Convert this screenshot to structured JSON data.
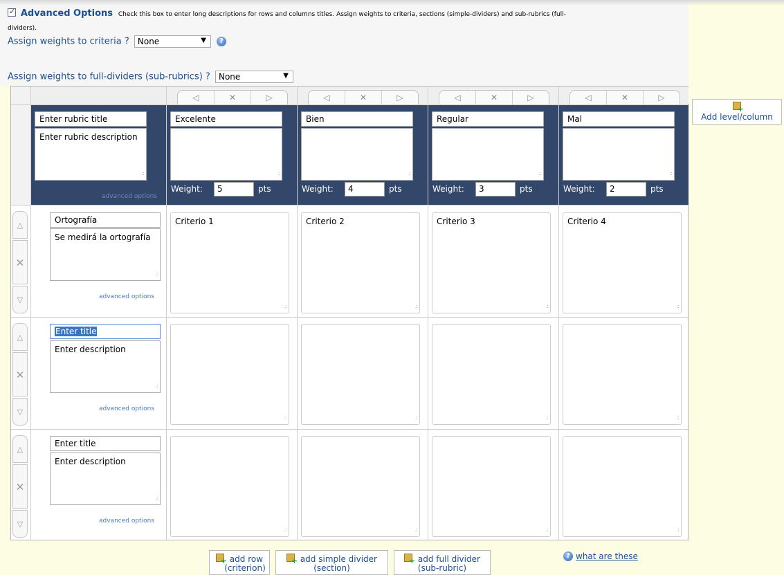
{
  "advanced": {
    "checked": true,
    "title": "Advanced Options",
    "description": "Check this box to enter long descriptions for rows and columns titles. Assign weights to criteria, sections (simple-dividers) and sub-rubrics (full-",
    "description_cont": "dividers)."
  },
  "criteria_weights": {
    "label": "Assign weights to criteria ?",
    "value": "None"
  },
  "divider_weights": {
    "label": "Assign weights to full-dividers (sub-rubrics) ?",
    "value": "None"
  },
  "rubric": {
    "title": "Enter rubric title",
    "description": "Enter rubric description",
    "advanced_label": "advanced options"
  },
  "columns": [
    {
      "title": "Excelente",
      "weight_label": "Weight:",
      "weight": "5",
      "unit": "pts"
    },
    {
      "title": "Bien",
      "weight_label": "Weight:",
      "weight": "4",
      "unit": "pts"
    },
    {
      "title": "Regular",
      "weight_label": "Weight:",
      "weight": "3",
      "unit": "pts"
    },
    {
      "title": "Mal",
      "weight_label": "Weight:",
      "weight": "2",
      "unit": "pts"
    }
  ],
  "nav_glyphs": {
    "left": "◁",
    "remove": "✕",
    "right": "▷"
  },
  "rows": [
    {
      "title": "Ortografía",
      "description": "Se medirá la ortografía",
      "advanced_label": "advanced options",
      "cells": [
        "Criterio 1",
        "Criterio 2",
        "Criterio 3",
        "Criterio 4"
      ]
    },
    {
      "title": "Enter title",
      "description": "Enter description",
      "advanced_label": "advanced options",
      "cells": [
        "",
        "",
        "",
        ""
      ]
    },
    {
      "title": "Enter title",
      "description": "Enter description",
      "advanced_label": "advanced options",
      "cells": [
        "",
        "",
        "",
        ""
      ]
    }
  ],
  "row_ctrl_glyphs": {
    "up": "△",
    "remove": "✕",
    "down": "▽"
  },
  "add_column": {
    "label": "Add level/column"
  },
  "bottom": {
    "add_row": {
      "line1": "add row",
      "line2": "(criterion)"
    },
    "add_simple": {
      "line1": "add simple divider",
      "line2": "(section)"
    },
    "add_full": {
      "line1": "add full divider",
      "line2": "(sub-rubric)"
    },
    "what_link": "what are these"
  },
  "icons": {
    "help": "help-icon",
    "add": "add-icon"
  },
  "colors": {
    "header_band": "#33476b",
    "accent": "#1b4f96",
    "page_bg": "#fdfde3"
  }
}
